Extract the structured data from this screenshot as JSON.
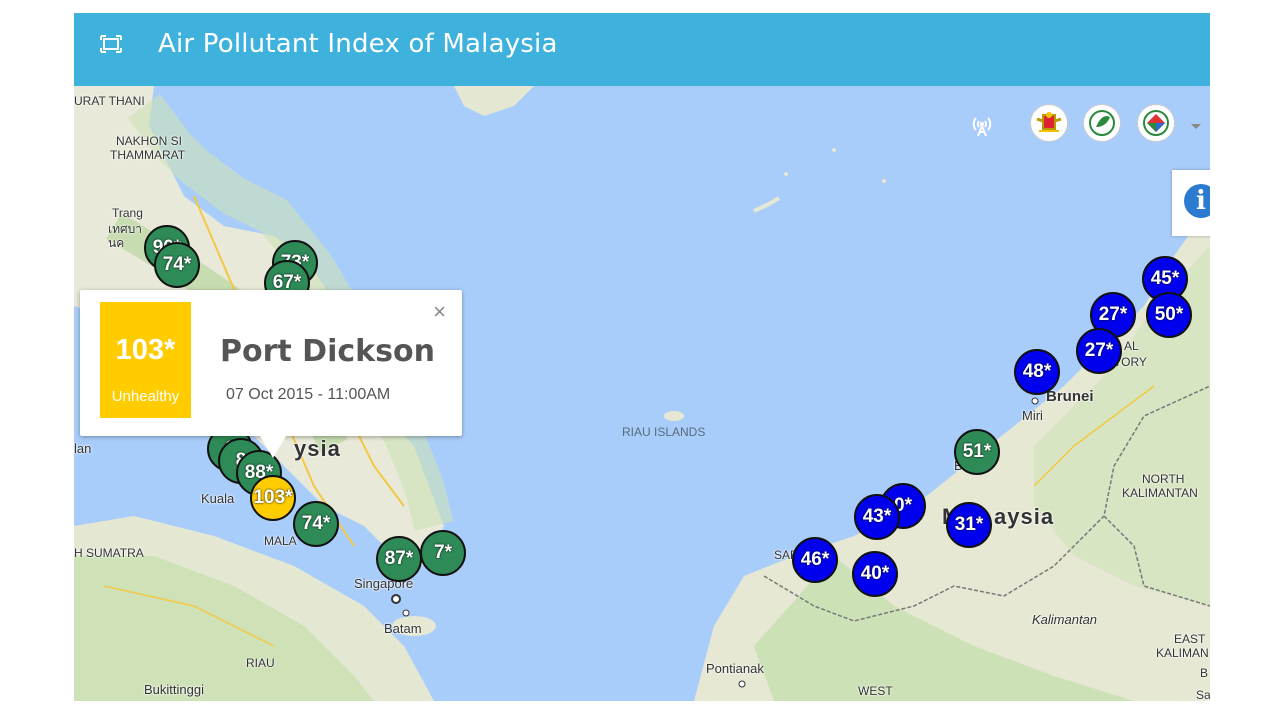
{
  "header": {
    "title": "Air Pollutant Index of Malaysia",
    "menu_icon": "expand-icon"
  },
  "colors": {
    "header": "#3eb1dc",
    "good": "#2e8b57",
    "good_blue": "#0000ee",
    "moderate": "#ffcc00"
  },
  "popup": {
    "value": "103*",
    "status": "Unhealthy",
    "station": "Port Dickson",
    "datetime": "07 Oct 2015 - 11:00AM",
    "close": "×"
  },
  "places": {
    "surat_thani": "URAT THANI",
    "nakhon": "NAKHON SI",
    "thammarat": "THAMMARAT",
    "trang": "Trang",
    "trang_thai": "เทศบา",
    "trang_thai2": "นค",
    "riau_islands": "RIAU ISLANDS",
    "malaysia_w": "ysia",
    "kuala": "Kuala",
    "mala": "MALA",
    "sumatra": "H SUMATRA",
    "singapore": "Singapore",
    "batam": "Batam",
    "riau": "RIAU",
    "bukittinggi": "Bukittinggi",
    "pontianak": "Pontianak",
    "west": "WEST",
    "brunei": "Brunei",
    "miri": "Miri",
    "bintulu": "B",
    "malaysia_e": "aysia",
    "malaysia_e_m": "M",
    "sarawak": "SAR",
    "al": "AL",
    "tory": "TORY",
    "north_kal": "NORTH",
    "north_kal2": "KALIMANTAN",
    "kalimantan": "Kalimantan",
    "east": "EAST",
    "east2": "KALIMAN",
    "b": "B",
    "sa": "Sa",
    "lan": "lan"
  },
  "markers": {
    "m1": "90*",
    "m2": "74*",
    "m3": "73*",
    "m4": "67*",
    "m5": "6",
    "m6": "8",
    "m7": "88*",
    "m8": "103*",
    "m9": "74*",
    "m10": "87*",
    "m11": "7*",
    "m12": "45*",
    "m13": "27*",
    "m14": "50*",
    "m15": "27*",
    "m16": "48*",
    "m17": "51*",
    "m18": "0*",
    "m19": "43*",
    "m20": "31*",
    "m21": "46*",
    "m22": "40*"
  }
}
